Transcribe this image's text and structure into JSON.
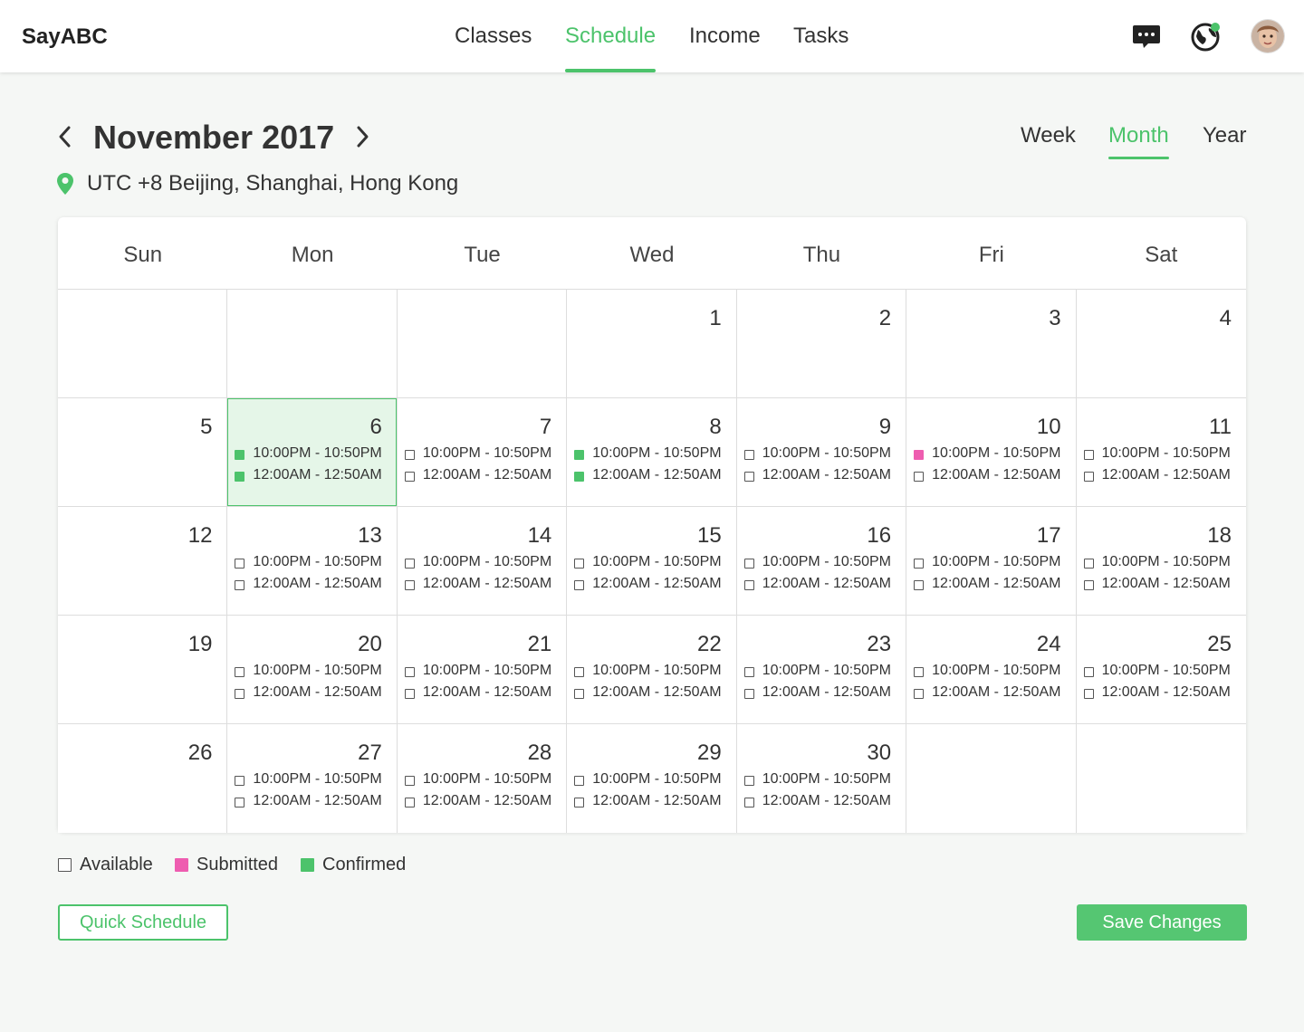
{
  "app": {
    "logo": "SayABC"
  },
  "nav": {
    "items": [
      {
        "label": "Classes",
        "active": false
      },
      {
        "label": "Schedule",
        "active": true
      },
      {
        "label": "Income",
        "active": false
      },
      {
        "label": "Tasks",
        "active": false
      }
    ]
  },
  "header_icons": [
    "chat-icon",
    "globe-icon",
    "avatar"
  ],
  "calendar_header": {
    "title": "November 2017",
    "prev_icon": "chevron-left-icon",
    "next_icon": "chevron-right-icon",
    "views": [
      {
        "label": "Week",
        "active": false
      },
      {
        "label": "Month",
        "active": true
      },
      {
        "label": "Year",
        "active": false
      }
    ],
    "timezone": "UTC +8 Beijing, Shanghai, Hong Kong",
    "timezone_icon": "location-pin-icon"
  },
  "colors": {
    "accent": "#4cc36b",
    "submitted": "#ee5db0",
    "confirmed": "#4cc36b",
    "highlight_bg": "#e5f6e8"
  },
  "calendar": {
    "weekdays": [
      "Sun",
      "Mon",
      "Tue",
      "Wed",
      "Thu",
      "Fri",
      "Sat"
    ],
    "weeks": [
      [
        null,
        null,
        null,
        {
          "day": "1",
          "slots": []
        },
        {
          "day": "2",
          "slots": []
        },
        {
          "day": "3",
          "slots": []
        },
        {
          "day": "4",
          "slots": []
        }
      ],
      [
        {
          "day": "5",
          "slots": []
        },
        {
          "day": "6",
          "highlight": true,
          "slots": [
            {
              "time": "10:00PM - 10:50PM",
              "status": "confirmed"
            },
            {
              "time": "12:00AM - 12:50AM",
              "status": "confirmed"
            }
          ]
        },
        {
          "day": "7",
          "slots": [
            {
              "time": "10:00PM - 10:50PM",
              "status": "available"
            },
            {
              "time": "12:00AM - 12:50AM",
              "status": "available"
            }
          ]
        },
        {
          "day": "8",
          "slots": [
            {
              "time": "10:00PM - 10:50PM",
              "status": "confirmed"
            },
            {
              "time": "12:00AM - 12:50AM",
              "status": "confirmed"
            }
          ]
        },
        {
          "day": "9",
          "slots": [
            {
              "time": "10:00PM - 10:50PM",
              "status": "available"
            },
            {
              "time": "12:00AM - 12:50AM",
              "status": "available"
            }
          ]
        },
        {
          "day": "10",
          "slots": [
            {
              "time": "10:00PM - 10:50PM",
              "status": "submitted"
            },
            {
              "time": "12:00AM - 12:50AM",
              "status": "available"
            }
          ]
        },
        {
          "day": "11",
          "slots": [
            {
              "time": "10:00PM - 10:50PM",
              "status": "available"
            },
            {
              "time": "12:00AM - 12:50AM",
              "status": "available"
            }
          ]
        }
      ],
      [
        {
          "day": "12",
          "slots": []
        },
        {
          "day": "13",
          "slots": [
            {
              "time": "10:00PM - 10:50PM",
              "status": "available"
            },
            {
              "time": "12:00AM - 12:50AM",
              "status": "available"
            }
          ]
        },
        {
          "day": "14",
          "slots": [
            {
              "time": "10:00PM - 10:50PM",
              "status": "available"
            },
            {
              "time": "12:00AM - 12:50AM",
              "status": "available"
            }
          ]
        },
        {
          "day": "15",
          "slots": [
            {
              "time": "10:00PM - 10:50PM",
              "status": "available"
            },
            {
              "time": "12:00AM - 12:50AM",
              "status": "available"
            }
          ]
        },
        {
          "day": "16",
          "slots": [
            {
              "time": "10:00PM - 10:50PM",
              "status": "available"
            },
            {
              "time": "12:00AM - 12:50AM",
              "status": "available"
            }
          ]
        },
        {
          "day": "17",
          "slots": [
            {
              "time": "10:00PM - 10:50PM",
              "status": "available"
            },
            {
              "time": "12:00AM - 12:50AM",
              "status": "available"
            }
          ]
        },
        {
          "day": "18",
          "slots": [
            {
              "time": "10:00PM - 10:50PM",
              "status": "available"
            },
            {
              "time": "12:00AM - 12:50AM",
              "status": "available"
            }
          ]
        }
      ],
      [
        {
          "day": "19",
          "slots": []
        },
        {
          "day": "20",
          "slots": [
            {
              "time": "10:00PM - 10:50PM",
              "status": "available"
            },
            {
              "time": "12:00AM - 12:50AM",
              "status": "available"
            }
          ]
        },
        {
          "day": "21",
          "slots": [
            {
              "time": "10:00PM - 10:50PM",
              "status": "available"
            },
            {
              "time": "12:00AM - 12:50AM",
              "status": "available"
            }
          ]
        },
        {
          "day": "22",
          "slots": [
            {
              "time": "10:00PM - 10:50PM",
              "status": "available"
            },
            {
              "time": "12:00AM - 12:50AM",
              "status": "available"
            }
          ]
        },
        {
          "day": "23",
          "slots": [
            {
              "time": "10:00PM - 10:50PM",
              "status": "available"
            },
            {
              "time": "12:00AM - 12:50AM",
              "status": "available"
            }
          ]
        },
        {
          "day": "24",
          "slots": [
            {
              "time": "10:00PM - 10:50PM",
              "status": "available"
            },
            {
              "time": "12:00AM - 12:50AM",
              "status": "available"
            }
          ]
        },
        {
          "day": "25",
          "slots": [
            {
              "time": "10:00PM - 10:50PM",
              "status": "available"
            },
            {
              "time": "12:00AM - 12:50AM",
              "status": "available"
            }
          ]
        }
      ],
      [
        {
          "day": "26",
          "slots": []
        },
        {
          "day": "27",
          "slots": [
            {
              "time": "10:00PM - 10:50PM",
              "status": "available"
            },
            {
              "time": "12:00AM - 12:50AM",
              "status": "available"
            }
          ]
        },
        {
          "day": "28",
          "slots": [
            {
              "time": "10:00PM - 10:50PM",
              "status": "available"
            },
            {
              "time": "12:00AM - 12:50AM",
              "status": "available"
            }
          ]
        },
        {
          "day": "29",
          "slots": [
            {
              "time": "10:00PM - 10:50PM",
              "status": "available"
            },
            {
              "time": "12:00AM - 12:50AM",
              "status": "available"
            }
          ]
        },
        {
          "day": "30",
          "slots": [
            {
              "time": "10:00PM - 10:50PM",
              "status": "available"
            },
            {
              "time": "12:00AM - 12:50AM",
              "status": "available"
            }
          ]
        },
        null,
        null
      ]
    ]
  },
  "legend": [
    {
      "label": "Available",
      "status": "available"
    },
    {
      "label": "Submitted",
      "status": "submitted"
    },
    {
      "label": "Confirmed",
      "status": "confirmed"
    }
  ],
  "actions": {
    "quick_schedule": "Quick Schedule",
    "save_changes": "Save Changes"
  }
}
